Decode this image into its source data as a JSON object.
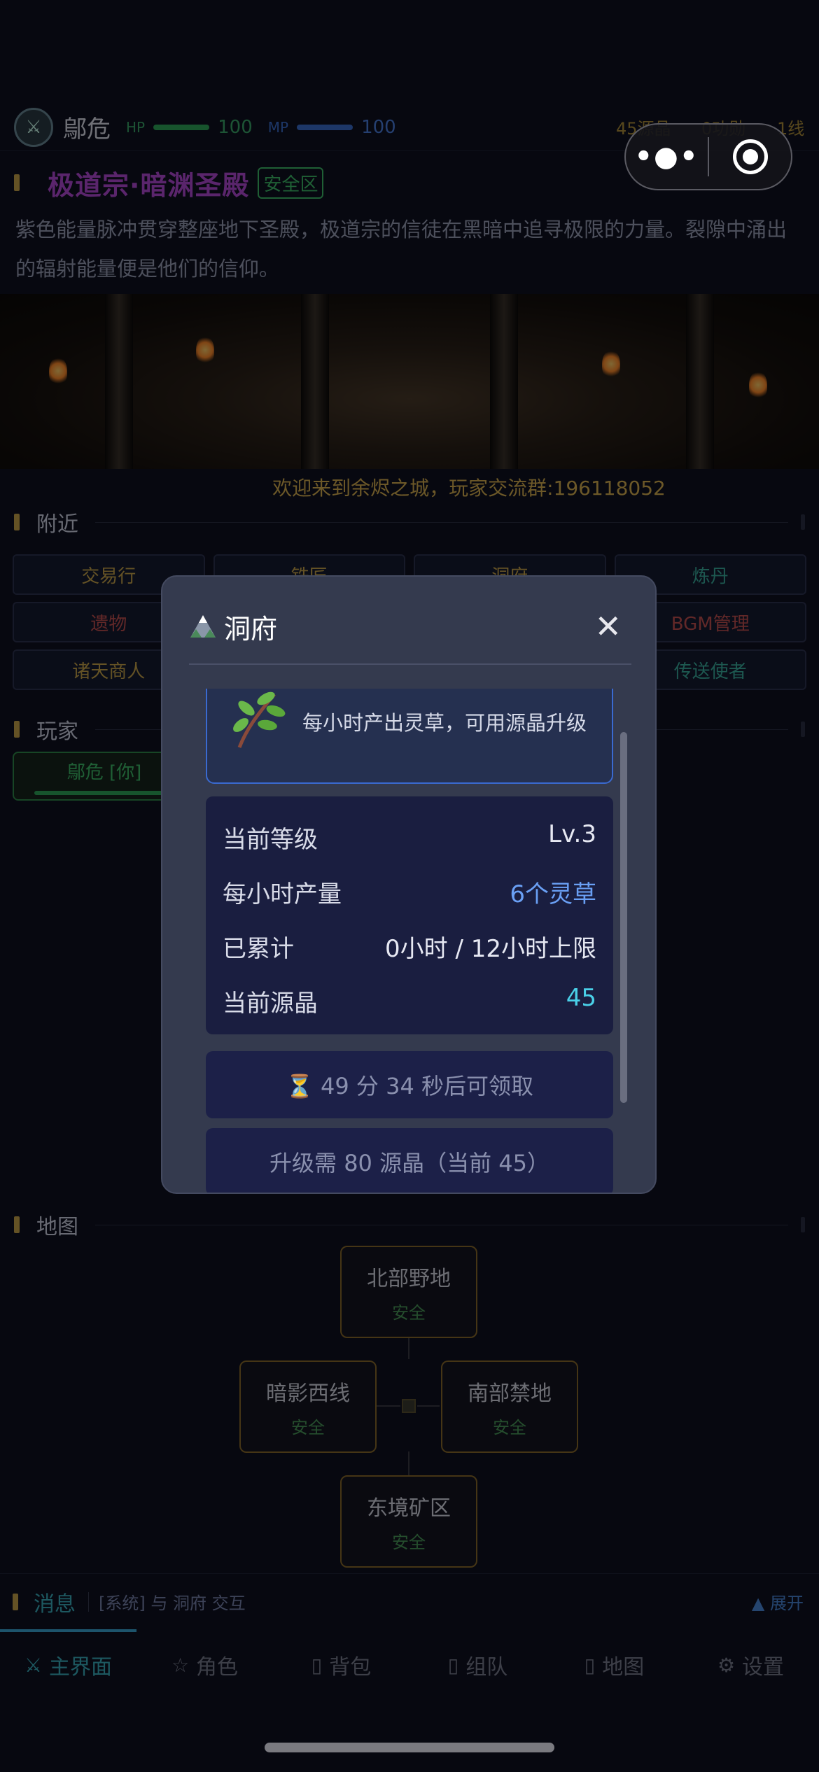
{
  "player": {
    "name": "鄔危",
    "hp_label": "HP",
    "hp_value": "100",
    "mp_label": "MP",
    "mp_value": "100",
    "avatar_icon": "crossed-swords-icon"
  },
  "resources": {
    "crystals": "45源晶",
    "merit": "0功勋",
    "line": "1线"
  },
  "location": {
    "title": "极道宗·暗渊圣殿",
    "badge": "安全区",
    "description": "紫色能量脉冲贯穿整座地下圣殿，极道宗的信徒在黑暗中追寻极限的力量。裂隙中涌出的辐射能量便是他们的信仰。"
  },
  "announcement": "欢迎来到余烬之城，玩家交流群:196118052",
  "nearby": {
    "title": "附近",
    "items": [
      {
        "label": "交易行",
        "color": "gold"
      },
      {
        "label": "铁匠",
        "color": "gold"
      },
      {
        "label": "洞府",
        "color": "gold"
      },
      {
        "label": "炼丹",
        "color": "teal"
      },
      {
        "label": "遗物",
        "color": "red"
      },
      {
        "label": "",
        "color": "gold"
      },
      {
        "label": "",
        "color": "gold"
      },
      {
        "label": "BGM管理",
        "color": "red"
      },
      {
        "label": "诸天商人",
        "color": "gold"
      },
      {
        "label": "",
        "color": "gold"
      },
      {
        "label": "",
        "color": "gold"
      },
      {
        "label": "传送使者",
        "color": "teal"
      }
    ]
  },
  "players": {
    "title": "玩家",
    "me": "鄔危 [你]"
  },
  "map": {
    "title": "地图",
    "nodes": {
      "north": {
        "name": "北部野地",
        "status": "安全"
      },
      "west": {
        "name": "暗影西线",
        "status": "安全"
      },
      "south": {
        "name": "南部禁地",
        "status": "安全"
      },
      "east": {
        "name": "东境矿区",
        "status": "安全"
      }
    }
  },
  "messages": {
    "title": "消息",
    "latest": "[系统] 与 洞府 交互",
    "expand": "▲ 展开"
  },
  "tabs": [
    {
      "label": "主界面",
      "icon": "crossed-swords-icon",
      "glyph": "⚔",
      "active": true
    },
    {
      "label": "角色",
      "icon": "star-icon",
      "glyph": "☆",
      "active": false
    },
    {
      "label": "背包",
      "icon": "bag-icon",
      "glyph": "▯",
      "active": false
    },
    {
      "label": "组队",
      "icon": "team-icon",
      "glyph": "▯",
      "active": false
    },
    {
      "label": "地图",
      "icon": "map-icon",
      "glyph": "▯",
      "active": false
    },
    {
      "label": "设置",
      "icon": "gear-icon",
      "glyph": "⚙",
      "active": false
    }
  ],
  "capsule": {
    "more_icon": "more-dots-icon",
    "close_icon": "target-icon"
  },
  "modal": {
    "title": "洞府",
    "title_icon": "mountain-icon",
    "close_icon": "close-icon",
    "feature": {
      "icon": "herb-icon",
      "description": "每小时产出灵草，可用源晶升级"
    },
    "stats": [
      {
        "label": "当前等级",
        "value": "Lv.3",
        "tone": "normal"
      },
      {
        "label": "每小时产量",
        "value": "6个灵草",
        "tone": "blue"
      },
      {
        "label": "已累计",
        "value": "0小时 / 12小时上限",
        "tone": "normal"
      },
      {
        "label": "当前源晶",
        "value": "45",
        "tone": "cyan"
      }
    ],
    "collect_label": "⏳ 49 分 34 秒后可领取",
    "upgrade_label": "升级需 80 源晶（当前 45）"
  },
  "colors": {
    "accent": "#3ab0c0",
    "gold": "#c9a44a",
    "purple_title": "#b44ad8",
    "safe": "#3fbf6a",
    "modal_bg": "#343a4e"
  }
}
